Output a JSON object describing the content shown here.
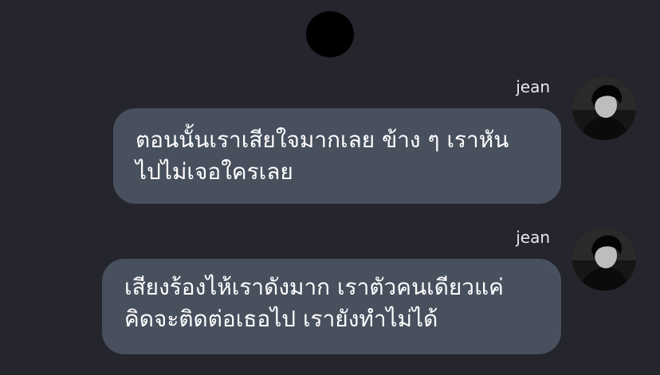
{
  "top_indicator": {
    "icon": "black-circle-icon"
  },
  "messages": [
    {
      "sender": "jean",
      "avatar_icon": "profile-photo-icon",
      "text": "ตอนนั้นเราเสียใจมากเลย ข้าง ๆ เราหัน\nไปไม่เจอใครเลย"
    },
    {
      "sender": "jean",
      "avatar_icon": "profile-photo-icon",
      "text": "เสียงร้องไห้เราดังมาก เราตัวคนเดียวแค่\nคิดจะติดต่อเธอไป เรายังทำไม่ได้"
    }
  ],
  "colors": {
    "background": "#24252d",
    "bubble": "#48505e",
    "text": "#ffffff"
  }
}
